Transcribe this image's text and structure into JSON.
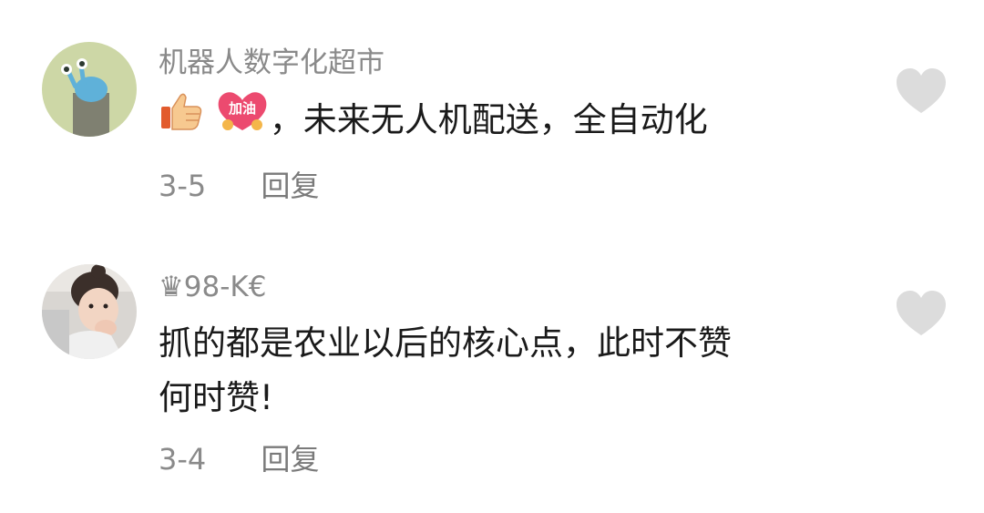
{
  "comments": [
    {
      "username": "机器人数字化超市",
      "emojis": [
        "thumbs-up-icon",
        "jiayou-sticker-icon"
      ],
      "sticker_text": "加油",
      "text": "，未来无人机配送，全自动化",
      "date": "3-5",
      "reply_label": "回复"
    },
    {
      "username_crown": "♛",
      "username": "98-K€",
      "text_line1": "抓的都是农业以后的核心点，此时不赞",
      "text_line2": "何时赞!",
      "date": "3-4",
      "reply_label": "回复"
    }
  ],
  "colors": {
    "meta_gray": "#8a8a8a",
    "like_gray": "#d9d9d9",
    "text": "#1a1a1a"
  }
}
